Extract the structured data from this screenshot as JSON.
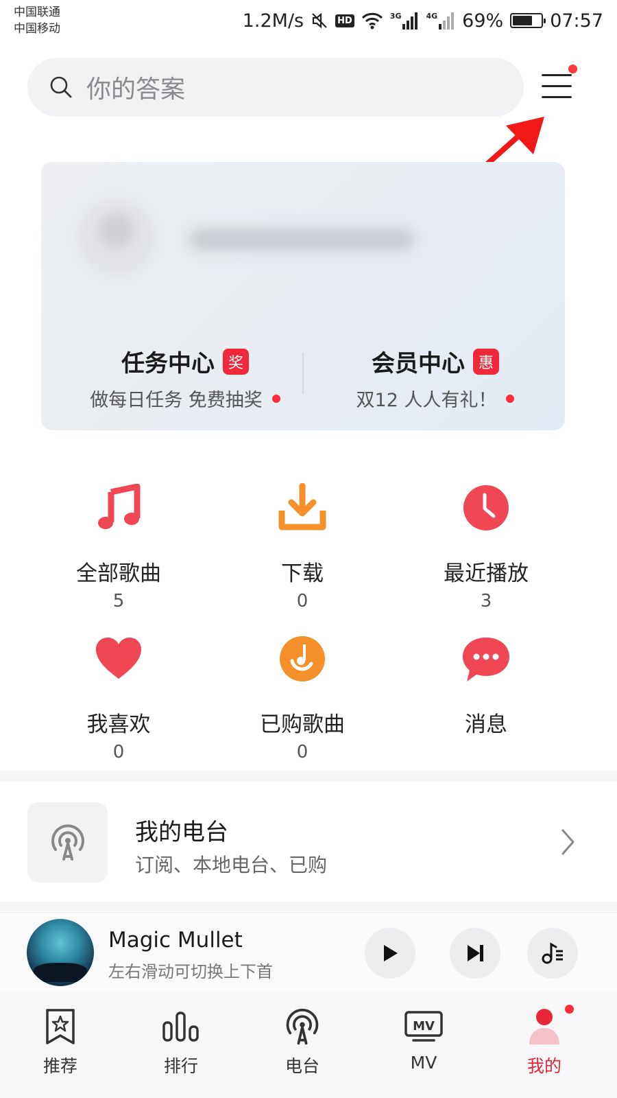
{
  "status_bar": {
    "carrier_1": "中国联通",
    "carrier_2": "中国移动",
    "net_speed": "1.2M/s",
    "hd": "HD",
    "sig_3g": "3G",
    "sig_4g": "4G",
    "battery": "69%",
    "battery_level": 0.69,
    "time": "07:57"
  },
  "search": {
    "placeholder": "你的答案"
  },
  "card": {
    "task": {
      "title": "任务中心",
      "badge": "奖",
      "sub": "做每日任务 免费抽奖"
    },
    "vip": {
      "title": "会员中心",
      "badge": "惠",
      "sub": "双12 人人有礼！"
    }
  },
  "grid": [
    {
      "label": "全部歌曲",
      "count": "5",
      "icon": "music-note-icon"
    },
    {
      "label": "下载",
      "count": "0",
      "icon": "download-icon"
    },
    {
      "label": "最近播放",
      "count": "3",
      "icon": "clock-icon"
    },
    {
      "label": "我喜欢",
      "count": "0",
      "icon": "heart-icon"
    },
    {
      "label": "已购歌曲",
      "count": "0",
      "icon": "purchased-disc-icon"
    },
    {
      "label": "消息",
      "count": "",
      "icon": "message-icon"
    }
  ],
  "radio": {
    "title": "我的电台",
    "sub": "订阅、本地电台、已购"
  },
  "player": {
    "title": "Magic Mullet",
    "sub": "左右滑动可切换上下首"
  },
  "tabs": [
    {
      "label": "推荐",
      "icon": "star-bookmark-icon"
    },
    {
      "label": "排行",
      "icon": "chart-bars-icon"
    },
    {
      "label": "电台",
      "icon": "radio-tower-icon"
    },
    {
      "label": "MV",
      "icon": "mv-tv-icon"
    },
    {
      "label": "我的",
      "icon": "profile-icon"
    }
  ],
  "colors": {
    "accent": "#e8263a",
    "badge": "#f0293a",
    "orange": "#f5902a",
    "red_icon": "#f04755"
  }
}
